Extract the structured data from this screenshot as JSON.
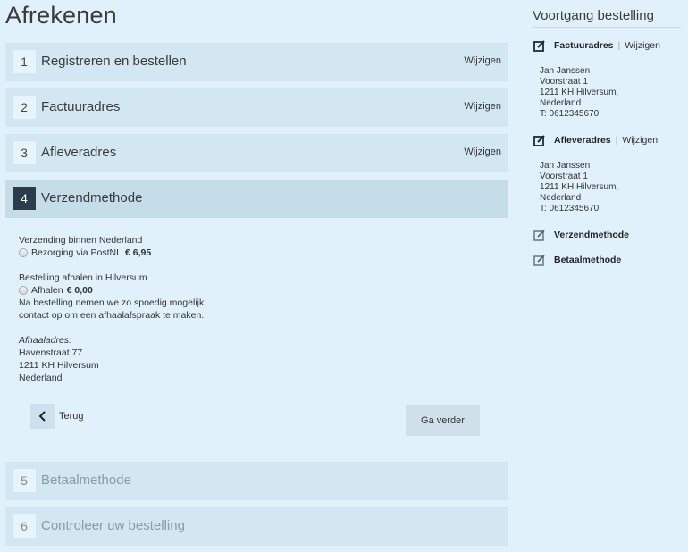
{
  "page": {
    "title": "Afrekenen"
  },
  "steps": [
    {
      "num": "1",
      "title": "Registreren en bestellen",
      "edit": "Wijzigen"
    },
    {
      "num": "2",
      "title": "Factuuradres",
      "edit": "Wijzigen"
    },
    {
      "num": "3",
      "title": "Afleveradres",
      "edit": "Wijzigen"
    },
    {
      "num": "4",
      "title": "Verzendmethode"
    },
    {
      "num": "5",
      "title": "Betaalmethode"
    },
    {
      "num": "6",
      "title": "Controleer uw bestelling"
    }
  ],
  "shipping": {
    "nl_heading": "Verzending binnen Nederland",
    "postnl_label": "Bezorging via PostNL",
    "postnl_price": "€ 6,95",
    "pickup_heading": "Bestelling afhalen in Hilversum",
    "pickup_label": "Afhalen",
    "pickup_price": "€ 0,00",
    "pickup_note_1": "Na bestelling nemen we zo spoedig mogelijk",
    "pickup_note_2": "contact op om een afhaalafspraak te maken.",
    "pickup_address_label": "Afhaaladres:",
    "pickup_address": [
      "Havenstraat 77",
      "1211 KH Hilversum",
      "Nederland"
    ]
  },
  "buttons": {
    "back": "Terug",
    "next": "Ga verder"
  },
  "sidebar": {
    "title": "Voortgang bestelling",
    "sections": [
      {
        "label": "Factuuradres",
        "edit": "Wijzigen",
        "icon": "edit-icon",
        "address": [
          "Jan Janssen",
          "Voorstraat 1",
          "1211 KH Hilversum,",
          "Nederland",
          "T: 0612345670"
        ]
      },
      {
        "label": "Afleveradres",
        "edit": "Wijzigen",
        "icon": "edit-icon",
        "address": [
          "Jan Janssen",
          "Voorstraat 1",
          "1211 KH Hilversum,",
          "Nederland",
          "T: 0612345670"
        ]
      },
      {
        "label": "Verzendmethode",
        "icon": "pencil-icon"
      },
      {
        "label": "Betaalmethode",
        "icon": "pencil-icon"
      }
    ]
  },
  "colors": {
    "background": "#e1f1fc",
    "step_bg": "#d3e7f3",
    "active_num_bg": "#2b3c4b"
  }
}
